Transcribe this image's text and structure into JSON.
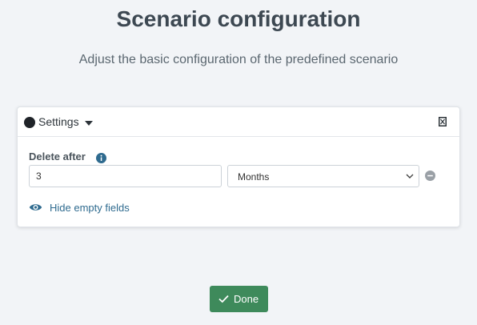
{
  "header": {
    "title": "Scenario configuration",
    "subtitle": "Adjust the basic configuration of the predefined scenario"
  },
  "panel": {
    "section_label": "Settings",
    "section_dot_color": "#1f2328",
    "field": {
      "label": "Delete after",
      "value": "3",
      "unit_selected": "Months"
    },
    "toggle_label": "Hide empty fields"
  },
  "footer": {
    "done_label": "Done",
    "done_color": "#3e8a5b"
  },
  "icons": {
    "header_collapse": "collapse-icon",
    "info": "info-icon",
    "select": "chevron-down-icon",
    "remove": "minus-circle-icon",
    "toggle": "eye-icon",
    "done": "check-icon"
  }
}
